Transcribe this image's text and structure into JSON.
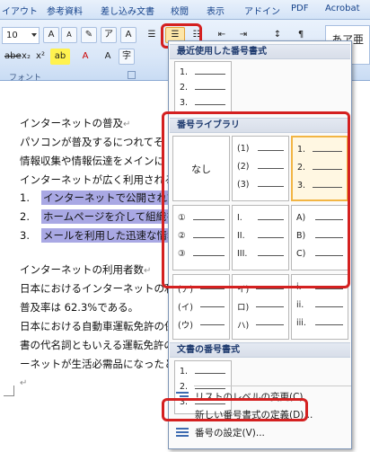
{
  "ribbon": {
    "tabs": [
      "イアウト",
      "参考資料",
      "差し込み文書",
      "校閲",
      "表示",
      "アドイン",
      "PDF",
      "Acrobat"
    ],
    "font_size": "10",
    "font_group_label": "フォント",
    "style_preview": "あア亜"
  },
  "document": {
    "lines": [
      "インターネットの普及",
      "パソコンが普及するにつれてそ",
      "情報収集や情報伝達をメインに",
      "インターネットが広く利用される"
    ],
    "list_items": [
      {
        "num": "1.",
        "text": "インターネットで公開されて"
      },
      {
        "num": "2.",
        "text": "ホームページを介して組織を"
      },
      {
        "num": "3.",
        "text": "メールを利用した迅速な情報"
      }
    ],
    "lines2": [
      "インターネットの利用者数",
      "日本におけるインターネットの利",
      "普及率は 62.3%である。",
      "日本における自動車運転免許の保",
      "書の代名詞ともいえる運転免許の",
      "ーネットが生活必需品になったと"
    ],
    "paragraph_mark": "↵"
  },
  "gallery": {
    "recent_header": "最近使用した番号書式",
    "library_header": "番号ライブラリ",
    "document_header": "文書の番号書式",
    "none_label": "なし",
    "recent_format": [
      "1.",
      "2.",
      "3."
    ],
    "library": [
      [
        "(1)",
        "(2)",
        "(3)"
      ],
      [
        "1.",
        "2.",
        "3."
      ],
      [
        "①",
        "②",
        "③"
      ],
      [
        "I.",
        "II.",
        "III."
      ],
      [
        "A)",
        "B)",
        "C)"
      ],
      [
        "(ア)",
        "(イ)",
        "(ウ)"
      ],
      [
        "イ)",
        "ロ)",
        "ハ)"
      ],
      [
        "i.",
        "ii.",
        "iii."
      ]
    ],
    "document_format": [
      "1.",
      "2.",
      "3."
    ],
    "menu_items": [
      "リストのレベルの変更(C)",
      "新しい番号書式の定義(D)...",
      "番号の設定(V)..."
    ]
  },
  "colors": {
    "highlight": "#d42020",
    "selection": "#a9a8e4",
    "selected_cell": "#f2b544"
  }
}
